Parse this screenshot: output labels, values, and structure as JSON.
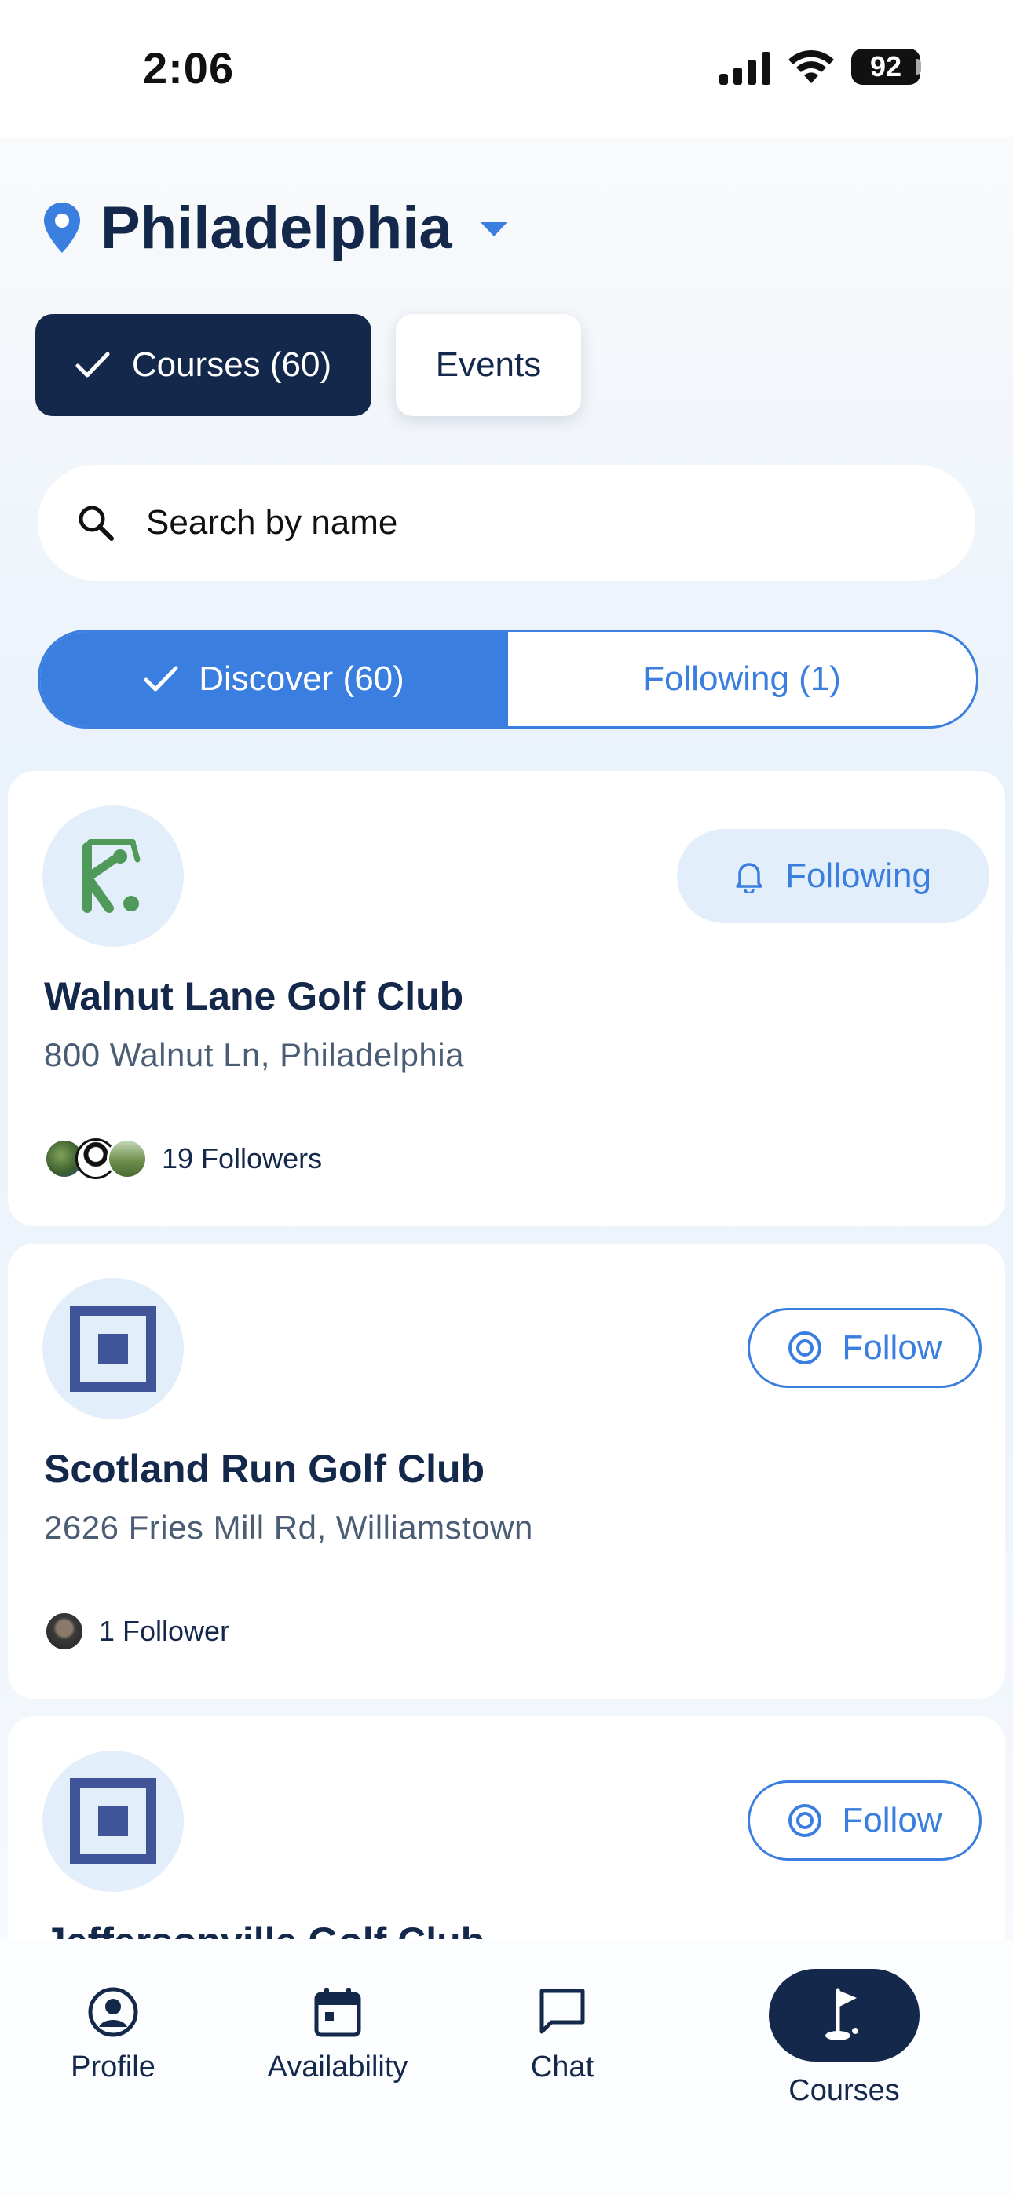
{
  "status_bar": {
    "time": "2:06",
    "battery": "92"
  },
  "location": {
    "city": "Philadelphia"
  },
  "top_tabs": {
    "courses_label": "Courses (60)",
    "events_label": "Events"
  },
  "search": {
    "placeholder": "Search by name"
  },
  "filter_toggle": {
    "discover_label": "Discover (60)",
    "following_label": "Following (1)"
  },
  "courses": [
    {
      "name": "Walnut Lane Golf Club",
      "address": "800 Walnut Ln, Philadelphia",
      "followers": "19 Followers",
      "action": "Following"
    },
    {
      "name": "Scotland Run Golf Club",
      "address": "2626 Fries Mill Rd, Williamstown",
      "followers": "1 Follower",
      "action": "Follow"
    },
    {
      "name": "Jeffersonville Golf Club",
      "action": "Follow"
    }
  ],
  "bottom_nav": [
    {
      "label": "Profile",
      "icon": "account-circle-icon"
    },
    {
      "label": "Availability",
      "icon": "calendar-icon"
    },
    {
      "label": "Chat",
      "icon": "chat-bubble-icon"
    },
    {
      "label": "Courses",
      "icon": "golf-flag-icon"
    }
  ],
  "colors": {
    "navy": "#14284b",
    "accent_blue": "#3a7ee0",
    "pill_bg": "#e3eefb",
    "golfer_green": "#4f9a5a",
    "square_logo": "#3f5597"
  }
}
